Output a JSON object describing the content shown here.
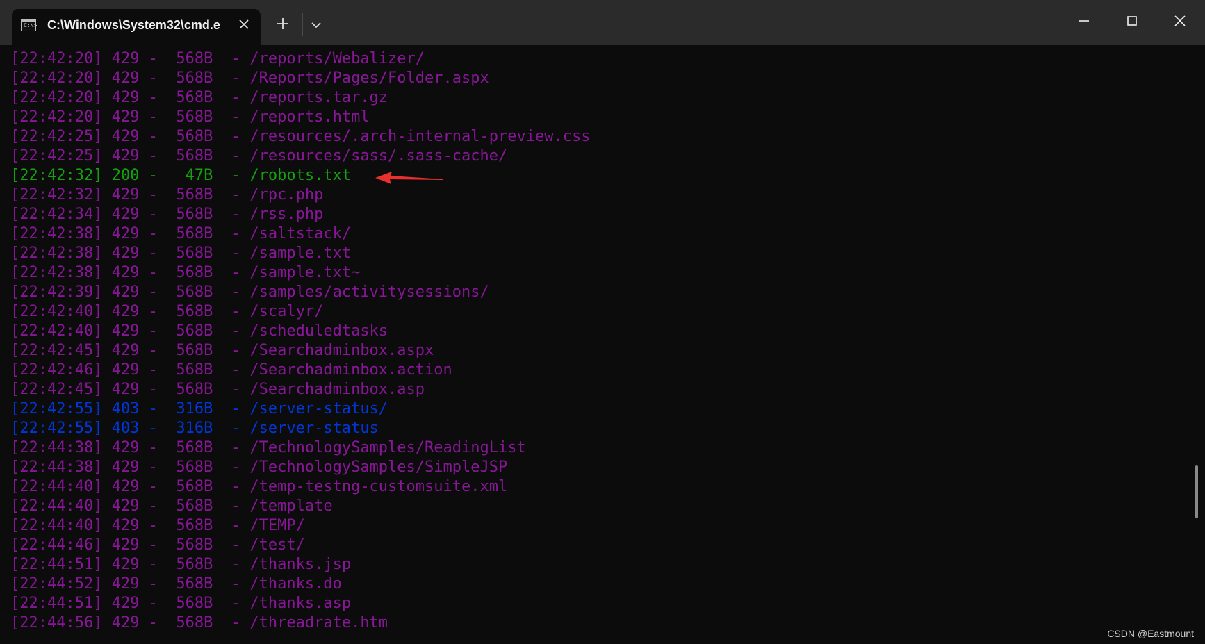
{
  "window": {
    "tab_title": "C:\\Windows\\System32\\cmd.e",
    "tab_icon": "console-icon",
    "tab_icon_glyph": "C:\\>",
    "new_tab_icon": "plus-icon",
    "dropdown_icon": "chevron-down-icon",
    "minimize_icon": "minimize-icon",
    "maximize_icon": "maximize-icon",
    "close_icon": "close-icon"
  },
  "colors": {
    "status_429": "#881798",
    "status_200": "#13a10e",
    "status_403": "#0037da",
    "annotation_arrow": "#e8312e"
  },
  "terminal": {
    "lines": [
      {
        "status": "429",
        "text": "[22:42:20] 429 -  568B  - /reports/Webalizer/"
      },
      {
        "status": "429",
        "text": "[22:42:20] 429 -  568B  - /Reports/Pages/Folder.aspx"
      },
      {
        "status": "429",
        "text": "[22:42:20] 429 -  568B  - /reports.tar.gz"
      },
      {
        "status": "429",
        "text": "[22:42:20] 429 -  568B  - /reports.html"
      },
      {
        "status": "429",
        "text": "[22:42:25] 429 -  568B  - /resources/.arch-internal-preview.css"
      },
      {
        "status": "429",
        "text": "[22:42:25] 429 -  568B  - /resources/sass/.sass-cache/"
      },
      {
        "status": "200",
        "text": "[22:42:32] 200 -   47B  - /robots.txt"
      },
      {
        "status": "429",
        "text": "[22:42:32] 429 -  568B  - /rpc.php"
      },
      {
        "status": "429",
        "text": "[22:42:34] 429 -  568B  - /rss.php"
      },
      {
        "status": "429",
        "text": "[22:42:38] 429 -  568B  - /saltstack/"
      },
      {
        "status": "429",
        "text": "[22:42:38] 429 -  568B  - /sample.txt"
      },
      {
        "status": "429",
        "text": "[22:42:38] 429 -  568B  - /sample.txt~"
      },
      {
        "status": "429",
        "text": "[22:42:39] 429 -  568B  - /samples/activitysessions/"
      },
      {
        "status": "429",
        "text": "[22:42:40] 429 -  568B  - /scalyr/"
      },
      {
        "status": "429",
        "text": "[22:42:40] 429 -  568B  - /scheduledtasks"
      },
      {
        "status": "429",
        "text": "[22:42:45] 429 -  568B  - /Searchadminbox.aspx"
      },
      {
        "status": "429",
        "text": "[22:42:46] 429 -  568B  - /Searchadminbox.action"
      },
      {
        "status": "429",
        "text": "[22:42:45] 429 -  568B  - /Searchadminbox.asp"
      },
      {
        "status": "403",
        "text": "[22:42:55] 403 -  316B  - /server-status/"
      },
      {
        "status": "403",
        "text": "[22:42:55] 403 -  316B  - /server-status"
      },
      {
        "status": "429",
        "text": "[22:44:38] 429 -  568B  - /TechnologySamples/ReadingList"
      },
      {
        "status": "429",
        "text": "[22:44:38] 429 -  568B  - /TechnologySamples/SimpleJSP"
      },
      {
        "status": "429",
        "text": "[22:44:40] 429 -  568B  - /temp-testng-customsuite.xml"
      },
      {
        "status": "429",
        "text": "[22:44:40] 429 -  568B  - /template"
      },
      {
        "status": "429",
        "text": "[22:44:40] 429 -  568B  - /TEMP/"
      },
      {
        "status": "429",
        "text": "[22:44:46] 429 -  568B  - /test/"
      },
      {
        "status": "429",
        "text": "[22:44:51] 429 -  568B  - /thanks.jsp"
      },
      {
        "status": "429",
        "text": "[22:44:52] 429 -  568B  - /thanks.do"
      },
      {
        "status": "429",
        "text": "[22:44:51] 429 -  568B  - /thanks.asp"
      },
      {
        "status": "429",
        "text": "[22:44:56] 429 -  568B  - /threadrate.htm"
      }
    ]
  },
  "watermark": "CSDN @Eastmount"
}
